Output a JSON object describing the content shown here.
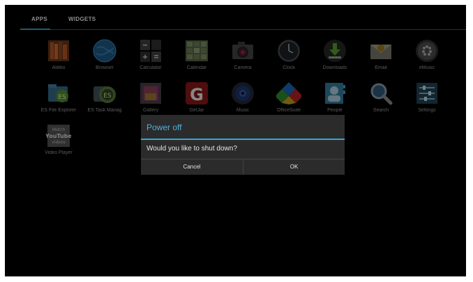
{
  "tabs": {
    "apps": "APPS",
    "widgets": "WIDGETS"
  },
  "apps": [
    {
      "label": "Aldiko",
      "icon": "books-icon"
    },
    {
      "label": "Browser",
      "icon": "globe-icon"
    },
    {
      "label": "Calculator",
      "icon": "calculator-icon"
    },
    {
      "label": "Calendar",
      "icon": "calendar-icon"
    },
    {
      "label": "Camera",
      "icon": "camera-icon"
    },
    {
      "label": "Clock",
      "icon": "clock-icon"
    },
    {
      "label": "Downloads",
      "icon": "download-icon"
    },
    {
      "label": "Email",
      "icon": "email-icon"
    },
    {
      "label": "eMusic",
      "icon": "emusic-icon"
    },
    {
      "label": "ES File Explorer",
      "icon": "folder-icon"
    },
    {
      "label": "ES Task Manag",
      "icon": "task-manager-icon"
    },
    {
      "label": "Gallery",
      "icon": "gallery-icon"
    },
    {
      "label": "GetJar",
      "icon": "getjar-icon"
    },
    {
      "label": "Music",
      "icon": "music-icon"
    },
    {
      "label": "OfficeSuite",
      "icon": "officesuite-icon"
    },
    {
      "label": "People",
      "icon": "contacts-icon"
    },
    {
      "label": "Search",
      "icon": "search-icon"
    },
    {
      "label": "Settings",
      "icon": "settings-icon"
    },
    {
      "label": "Video Player",
      "icon": "youtube-icon",
      "icon_text": [
        "Watch",
        "YouTube",
        "videos"
      ]
    }
  ],
  "dialog": {
    "title": "Power off",
    "message": "Would you like to shut down?",
    "cancel": "Cancel",
    "ok": "OK"
  },
  "colors": {
    "accent": "#33a5d6",
    "dialog_bg": "#2b2b2b",
    "background": "#000000"
  }
}
